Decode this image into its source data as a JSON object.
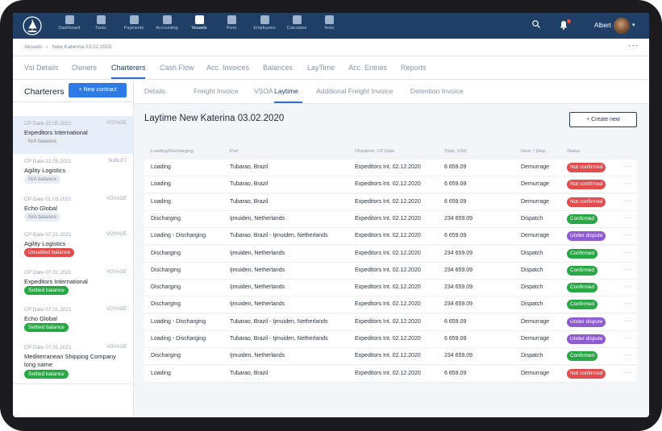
{
  "nav": {
    "items": [
      {
        "label": "Dashboard",
        "icon": "dashboard-icon"
      },
      {
        "label": "Tasks",
        "icon": "tasks-icon"
      },
      {
        "label": "Payments",
        "icon": "payments-icon"
      },
      {
        "label": "Accounting",
        "icon": "accounting-icon"
      },
      {
        "label": "Vessels",
        "icon": "vessels-icon"
      },
      {
        "label": "Ports",
        "icon": "anchor-icon"
      },
      {
        "label": "Employees",
        "icon": "employees-icon"
      },
      {
        "label": "Calculator",
        "icon": "calculator-icon"
      },
      {
        "label": "Tests",
        "icon": "tests-icon"
      }
    ],
    "active": "Vessels",
    "user_name": "Albert"
  },
  "breadcrumb": {
    "root": "Vessels",
    "current": "New Katerina 03.02.2020"
  },
  "main_tabs": [
    "Vsl Details",
    "Owners",
    "Charterers",
    "Cash Flow",
    "Acc. Invoices",
    "Balances",
    "LayTime",
    "Acc. Entries",
    "Reports"
  ],
  "main_tab_active": "Charterers",
  "sidebar": {
    "title": "Charterers",
    "new_button": "New contract",
    "cards": [
      {
        "date": "CP Date 22.05.2021",
        "kind": "VOYAGE",
        "name": "Expeditors International",
        "badge": "N/A balance",
        "badge_type": "na"
      },
      {
        "date": "CP Date 22.05.2021",
        "kind": "SUBLET",
        "name": "Agility Logistics",
        "badge": "N/A balance",
        "badge_type": "na"
      },
      {
        "date": "CP Date 01.03.2021",
        "kind": "VOYAGE",
        "name": "Echo Global",
        "badge": "N/A balance",
        "badge_type": "na"
      },
      {
        "date": "CP Date 07.01.2021",
        "kind": "VOYAGE",
        "name": "Agility Logistics",
        "badge": "Unsettled balance",
        "badge_type": "unsettled"
      },
      {
        "date": "CP Date 07.01.2021",
        "kind": "VOYAGE",
        "name": "Expeditors International",
        "badge": "Settled balance",
        "badge_type": "settled"
      },
      {
        "date": "CP Date 07.01.2021",
        "kind": "VOYAGE",
        "name": "Echo Global",
        "badge": "Settled balance",
        "badge_type": "settled"
      },
      {
        "date": "CP Date 07.01.2021",
        "kind": "VOYAGE",
        "name": "Mediterranean Shipping Company long name",
        "badge": "Settled balance",
        "badge_type": "settled"
      }
    ]
  },
  "sub_tabs": [
    "Details",
    "Freight Invoice",
    "VSOA",
    "Laytime",
    "Additional Freight Invoice",
    "Detention Invoice"
  ],
  "sub_tab_active": "Laytime",
  "page_title": "Laytime New Katerina 03.02.2020",
  "create_button": "Create new",
  "table": {
    "headers": [
      "Loading/Discharging",
      "Port",
      "Charterer, CP Date",
      "Total, USD",
      "Dem. / Disp.",
      "Status"
    ],
    "rows": [
      {
        "op": "Loading",
        "port": "Tubarao, Brazil",
        "charterer": "Expeditors Int. 02.12.2020",
        "total": "6 659.09",
        "dem": "Demurrage",
        "status": "Not confirmed",
        "status_type": "red"
      },
      {
        "op": "Loading",
        "port": "Tubarao, Brazil",
        "charterer": "Expeditors Int. 02.12.2020",
        "total": "6 659.09",
        "dem": "Demurrage",
        "status": "Not confirmed",
        "status_type": "red"
      },
      {
        "op": "Loading",
        "port": "Tubarao, Brazil",
        "charterer": "Expeditors Int. 02.12.2020",
        "total": "6 659.09",
        "dem": "Demurrage",
        "status": "Not confirmed",
        "status_type": "red"
      },
      {
        "op": "Discharging",
        "port": "Ijmuiden, Netherlands",
        "charterer": "Expeditors Int. 02.12.2020",
        "total": "234 659.09",
        "dem": "Dispatch",
        "status": "Confirmed",
        "status_type": "green"
      },
      {
        "op": "Loading - Discharging",
        "port": "Tubarao, Brazil - Ijmuiden, Netherlands",
        "charterer": "Expeditors Int. 02.12.2020",
        "total": "6 659.09",
        "dem": "Demurrage",
        "status": "Under dispute",
        "status_type": "purple"
      },
      {
        "op": "Discharging",
        "port": "Ijmuiden, Netherlands",
        "charterer": "Expeditors Int. 02.12.2020",
        "total": "234 659.09",
        "dem": "Dispatch",
        "status": "Confirmed",
        "status_type": "green"
      },
      {
        "op": "Discharging",
        "port": "Ijmuiden, Netherlands",
        "charterer": "Expeditors Int. 02.12.2020",
        "total": "234 659.09",
        "dem": "Dispatch",
        "status": "Confirmed",
        "status_type": "green"
      },
      {
        "op": "Discharging",
        "port": "Ijmuiden, Netherlands",
        "charterer": "Expeditors Int. 02.12.2020",
        "total": "234 659.09",
        "dem": "Dispatch",
        "status": "Confirmed",
        "status_type": "green"
      },
      {
        "op": "Discharging",
        "port": "Ijmuiden, Netherlands",
        "charterer": "Expeditors Int. 02.12.2020",
        "total": "234 659.09",
        "dem": "Dispatch",
        "status": "Confirmed",
        "status_type": "green"
      },
      {
        "op": "Loading - Discharging",
        "port": "Tubarao, Brazil - Ijmuiden, Netherlands",
        "charterer": "Expeditors Int. 02.12.2020",
        "total": "6 659.09",
        "dem": "Demurrage",
        "status": "Under dispute",
        "status_type": "purple"
      },
      {
        "op": "Loading - Discharging",
        "port": "Tubarao, Brazil - Ijmuiden, Netherlands",
        "charterer": "Expeditors Int. 02.12.2020",
        "total": "6 659.09",
        "dem": "Demurrage",
        "status": "Under dispute",
        "status_type": "purple"
      },
      {
        "op": "Discharging",
        "port": "Ijmuiden, Netherlands",
        "charterer": "Expeditors Int. 02.12.2020",
        "total": "234 659.09",
        "dem": "Dispatch",
        "status": "Confirmed",
        "status_type": "green"
      },
      {
        "op": "Loading",
        "port": "Tubarao, Brazil",
        "charterer": "Expeditors Int. 02.12.2020",
        "total": "6 659.09",
        "dem": "Demurrage",
        "status": "Not confirmed",
        "status_type": "red"
      }
    ]
  },
  "colors": {
    "nav_bg": "#1f3f66",
    "primary": "#2f7be5",
    "confirmed": "#28a745",
    "not_confirmed": "#e24c4c",
    "under_dispute": "#8e5bd0"
  }
}
